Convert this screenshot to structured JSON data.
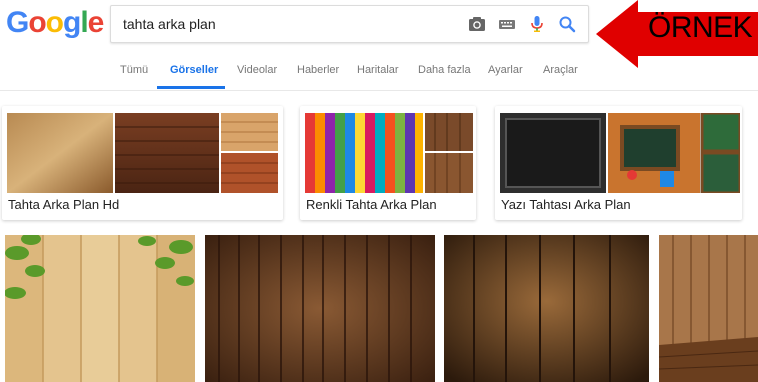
{
  "logo": {
    "letters": [
      "G",
      "o",
      "o",
      "g",
      "l",
      "e"
    ],
    "colors": [
      "#4285F4",
      "#EA4335",
      "#FBBC05",
      "#4285F4",
      "#34A853",
      "#EA4335"
    ]
  },
  "search": {
    "query": "tahta arka plan",
    "icons": [
      "camera-icon",
      "keyboard-icon",
      "mic-icon",
      "search-icon"
    ]
  },
  "tabs": [
    {
      "label": "Tümü",
      "active": false
    },
    {
      "label": "Görseller",
      "active": true
    },
    {
      "label": "Videolar",
      "active": false
    },
    {
      "label": "Haberler",
      "active": false
    },
    {
      "label": "Haritalar",
      "active": false
    },
    {
      "label": "Daha fazla",
      "active": false
    },
    {
      "label": "Ayarlar",
      "active": false
    },
    {
      "label": "Araçlar",
      "active": false
    }
  ],
  "annotation": {
    "label": "ÖRNEK",
    "color": "#e00000"
  },
  "related": [
    {
      "label": "Tahta Arka Plan Hd"
    },
    {
      "label": "Renkli Tahta Arka Plan"
    },
    {
      "label": "Yazı Tahtası Arka Plan"
    }
  ],
  "colors": {
    "accent": "#1a73e8",
    "tab_text": "#777777"
  }
}
